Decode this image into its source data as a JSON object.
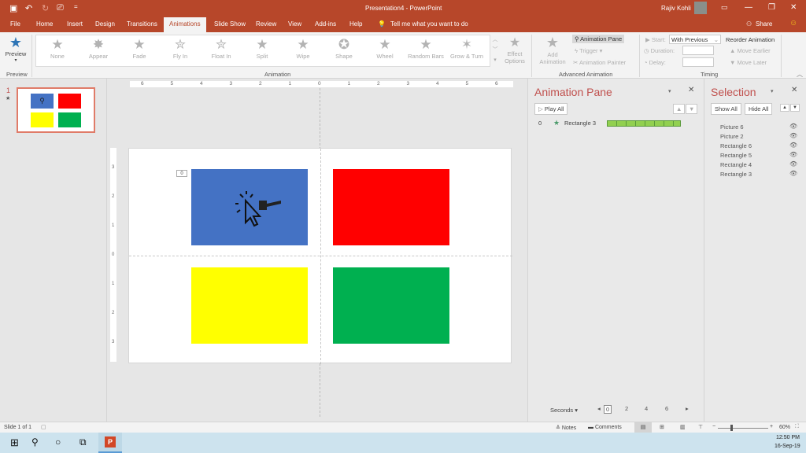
{
  "window": {
    "title": "Presentation4 - PowerPoint",
    "user": "Rajiv Kohli",
    "minimize": "—",
    "restore": "❐",
    "close": "✕"
  },
  "qat": {
    "save": "💾",
    "undo": "↶",
    "redo": "↻",
    "present": "⎚",
    "more": "="
  },
  "tabs": [
    "File",
    "Home",
    "Insert",
    "Design",
    "Transitions",
    "Animations",
    "Slide Show",
    "Review",
    "View",
    "Add-ins",
    "Help"
  ],
  "active_tab": "Animations",
  "tell_me": "Tell me what you want to do",
  "share_label": "Share",
  "ribbon": {
    "preview_label": "Preview",
    "preview_group": "Preview",
    "animation_group": "Animation",
    "animations": [
      "None",
      "Appear",
      "Fade",
      "Fly In",
      "Float In",
      "Split",
      "Wipe",
      "Shape",
      "Wheel",
      "Random Bars",
      "Grow & Turn"
    ],
    "effect_options": "Effect Options",
    "add_animation": "Add Animation",
    "animation_pane": "Animation Pane",
    "trigger": "Trigger",
    "animation_painter": "Animation Painter",
    "advanced_group": "Advanced Animation",
    "start_label": "Start:",
    "start_value": "With Previous",
    "duration_label": "Duration:",
    "delay_label": "Delay:",
    "timing_group": "Timing",
    "reorder_label": "Reorder Animation",
    "move_earlier": "Move Earlier",
    "move_later": "Move Later"
  },
  "thumbnail": {
    "number": "1",
    "star": "★"
  },
  "slide": {
    "animation_tag": "0",
    "shapes": [
      {
        "name": "Rectangle 3",
        "color": "#4472c4"
      },
      {
        "name": "Rectangle 4",
        "color": "#ff0000"
      },
      {
        "name": "Rectangle 5",
        "color": "#ffff00"
      },
      {
        "name": "Rectangle 6",
        "color": "#00b050"
      }
    ]
  },
  "ruler": {
    "horizontal": [
      "6",
      "5",
      "4",
      "3",
      "2",
      "1",
      "0",
      "1",
      "2",
      "3",
      "4",
      "5",
      "6"
    ],
    "vertical": [
      "3",
      "2",
      "1",
      "0",
      "1",
      "2",
      "3"
    ]
  },
  "animation_pane": {
    "title": "Animation Pane",
    "play_all": "Play All",
    "items": [
      {
        "index": "0",
        "name": "Rectangle 3"
      }
    ],
    "seconds_label": "Seconds",
    "timeline": [
      "0",
      "2",
      "4",
      "6"
    ]
  },
  "selection_pane": {
    "title": "Selection",
    "show_all": "Show All",
    "hide_all": "Hide All",
    "items": [
      "Picture 6",
      "Picture 2",
      "Rectangle 6",
      "Rectangle 5",
      "Rectangle 4",
      "Rectangle 3"
    ]
  },
  "status": {
    "slide_info": "Slide 1 of 1",
    "notes": "Notes",
    "comments": "Comments",
    "zoom": "60%"
  },
  "taskbar": {
    "time": "12:50 PM",
    "date": "16-Sep-19"
  }
}
